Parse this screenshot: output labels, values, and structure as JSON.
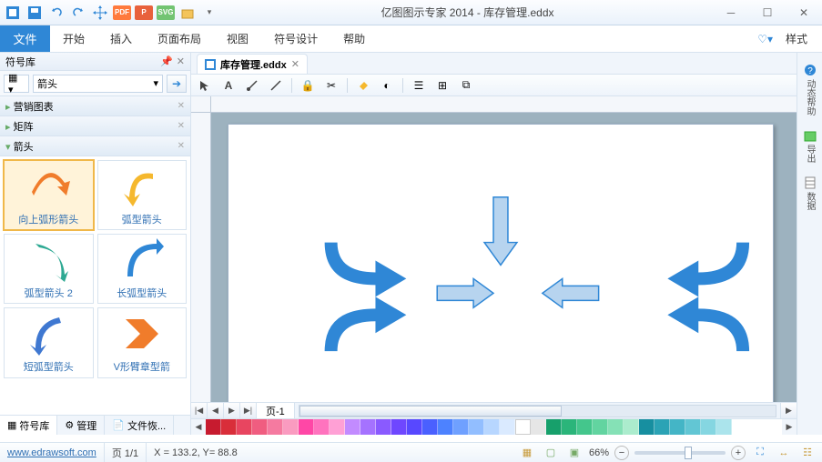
{
  "app": {
    "title": "亿图图示专家 2014 - 库存管理.eddx"
  },
  "menu": {
    "file": "文件",
    "items": [
      "开始",
      "插入",
      "页面布局",
      "视图",
      "符号设计",
      "帮助"
    ],
    "style": "样式"
  },
  "left_panel": {
    "title": "符号库",
    "selector": "箭头",
    "sections": [
      "营销图表",
      "矩阵",
      "箭头"
    ],
    "shapes": [
      {
        "label": "向上弧形箭头"
      },
      {
        "label": "弧型箭头"
      },
      {
        "label": "弧型箭头 2"
      },
      {
        "label": "长弧型箭头"
      },
      {
        "label": "短弧型箭头"
      },
      {
        "label": "V形臂章型箭"
      }
    ],
    "tabs": [
      "符号库",
      "管理",
      "文件恢..."
    ]
  },
  "doc": {
    "tab_label": "库存管理.eddx",
    "page_tab": "页-1"
  },
  "right_tabs": [
    "动态帮助",
    "导出",
    "数据"
  ],
  "palette": [
    "#c71b2f",
    "#e23a3a",
    "#ff4d4d",
    "#ff6f80",
    "#ffb3c0",
    "#ffd6df",
    "#ff4da6",
    "#ff80c1",
    "#ffb3d9",
    "#d7a8ff",
    "#b38bff",
    "#9a78ff",
    "#7a5cff",
    "#5e4aff",
    "#4a47ff",
    "#3d6bff",
    "#4f8cff",
    "#6fa8ff",
    "#8fc2ff",
    "#b3d8ff",
    "#d6ecff",
    "#ffffff",
    "#e8e8e8",
    "#d0d0d0",
    "#2bb36b",
    "#3cc97a",
    "#52d98d",
    "#6ee6a1",
    "#8cf2b7",
    "#aef8cc",
    "#17a2b8",
    "#2bb5c9",
    "#45c4d6",
    "#63d1df",
    "#86dde8",
    "#aae8ef"
  ],
  "status": {
    "url": "www.edrawsoft.com",
    "pages": "页 1/1",
    "coords": "X = 133.2, Y= 88.8",
    "zoom": "66%"
  }
}
